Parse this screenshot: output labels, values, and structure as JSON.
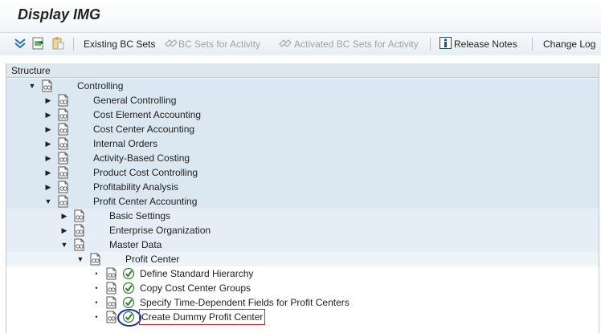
{
  "window": {
    "title": "Display IMG"
  },
  "toolbar": {
    "existing_bc_sets": "Existing BC Sets",
    "bc_sets_for_activity": "BC Sets for Activity",
    "activated_bc_sets_for_activity": "Activated BC Sets for Activity",
    "release_notes": "Release Notes",
    "change_log": "Change Log"
  },
  "tree": {
    "header": "Structure",
    "nodes": [
      {
        "label": "Controlling",
        "level": 0,
        "expander": "expanded"
      },
      {
        "label": "General Controlling",
        "level": 1,
        "expander": "collapsed"
      },
      {
        "label": "Cost Element Accounting",
        "level": 1,
        "expander": "collapsed"
      },
      {
        "label": "Cost Center Accounting",
        "level": 1,
        "expander": "collapsed"
      },
      {
        "label": "Internal Orders",
        "level": 1,
        "expander": "collapsed"
      },
      {
        "label": "Activity-Based Costing",
        "level": 1,
        "expander": "collapsed"
      },
      {
        "label": "Product Cost Controlling",
        "level": 1,
        "expander": "collapsed"
      },
      {
        "label": "Profitability Analysis",
        "level": 1,
        "expander": "collapsed"
      },
      {
        "label": "Profit Center Accounting",
        "level": 1,
        "expander": "expanded"
      },
      {
        "label": "Basic Settings",
        "level": 2,
        "expander": "collapsed"
      },
      {
        "label": "Enterprise Organization",
        "level": 2,
        "expander": "collapsed"
      },
      {
        "label": "Master Data",
        "level": 2,
        "expander": "expanded"
      },
      {
        "label": "Profit Center",
        "level": 3,
        "expander": "expanded"
      },
      {
        "label": "Define Standard Hierarchy",
        "level": 4,
        "expander": "leaf"
      },
      {
        "label": "Copy Cost Center Groups",
        "level": 4,
        "expander": "leaf"
      },
      {
        "label": "Specify Time-Dependent Fields for Profit Centers",
        "level": 4,
        "expander": "leaf"
      },
      {
        "label": "Create Dummy Profit Center",
        "level": 4,
        "expander": "leaf",
        "selected": true
      }
    ]
  }
}
